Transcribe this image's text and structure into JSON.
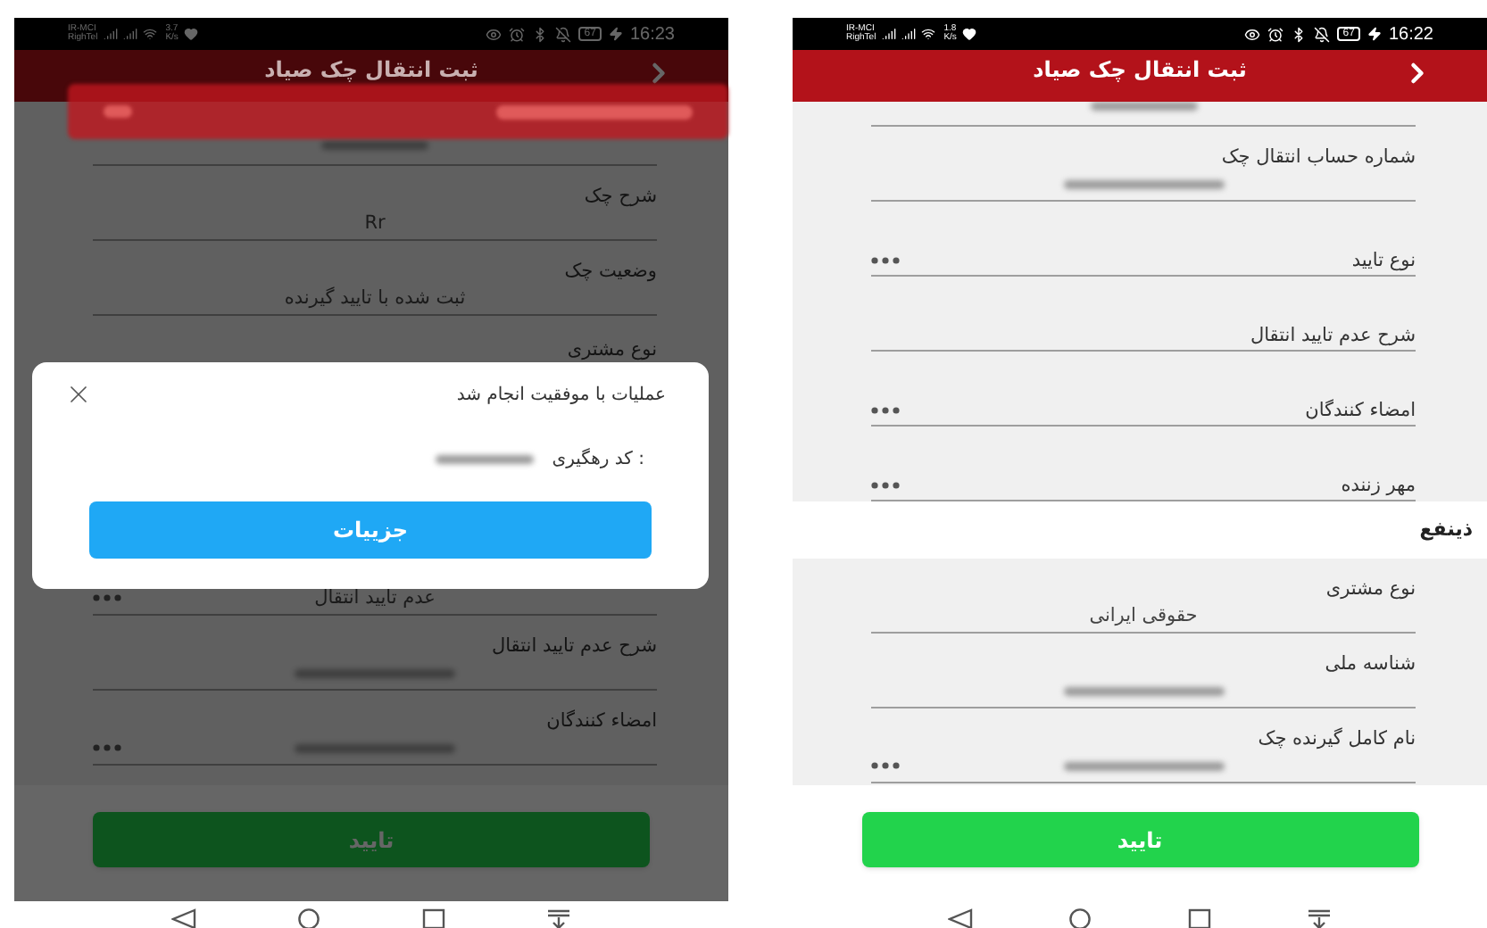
{
  "phones": [
    {
      "status_bar": {
        "carrier": "IR-MCI",
        "carrier_2": "RighTel",
        "speed": "1.8",
        "speed_unit": "K/s",
        "battery": "67",
        "time": "16:22"
      },
      "title": "ثبت انتقال چک صیاد",
      "toast_shown": false,
      "dimmed": false,
      "items": [
        {
          "kind": "partial",
          "blurred": true
        },
        {
          "kind": "field",
          "label": "شماره حساب انتقال چک",
          "blurred": true,
          "menu": false
        },
        {
          "kind": "field",
          "label": "نوع تایید",
          "blurred": false,
          "menu": true
        },
        {
          "kind": "field",
          "label": "شرح عدم تایید انتقال",
          "blurred": false,
          "menu": false
        },
        {
          "kind": "field",
          "label": "امضاء کنندگان",
          "blurred": false,
          "menu": true
        },
        {
          "kind": "field",
          "label": "مهر زننده",
          "blurred": false,
          "menu": true
        },
        {
          "kind": "section",
          "label": "ذینفع"
        },
        {
          "kind": "field",
          "label": "نوع مشتری",
          "value": "حقوقی ایرانی",
          "menu": false
        },
        {
          "kind": "field",
          "label": "شناسه ملی",
          "blurred": true,
          "menu": false
        },
        {
          "kind": "field",
          "label": "نام کامل گیرنده چک",
          "blurred": true,
          "menu": true
        }
      ],
      "confirm_button": "تایید"
    },
    {
      "status_bar": {
        "carrier": "IR-MCI",
        "carrier_2": "RighTel",
        "speed": "3.7",
        "speed_unit": "K/s",
        "battery": "67",
        "time": "16:23"
      },
      "title": "ثبت انتقال چک صیاد",
      "toast_shown": true,
      "dimmed": true,
      "items": [
        {
          "kind": "partial",
          "blurred": true
        },
        {
          "kind": "field",
          "label": "شرح چک",
          "value": "Rr",
          "menu": false
        },
        {
          "kind": "field",
          "label": "وضعیت چک",
          "value": "ثبت شده با تایید گیرنده",
          "menu": false
        },
        {
          "kind": "covered",
          "label": "نوع مشتری"
        }
      ],
      "items_below": [
        {
          "kind": "field",
          "value": "عدم تایید انتقال",
          "menu": true
        },
        {
          "kind": "field",
          "label": "شرح عدم تایید انتقال",
          "blurred": true,
          "menu": false
        },
        {
          "kind": "field",
          "label": "امضاء کنندگان",
          "blurred": true,
          "menu": true
        }
      ],
      "dialog": {
        "message": "عملیات با موفقیت انجام شد",
        "code_label": "کد رهگیری :",
        "code_blurred": true,
        "button": "جزییات"
      },
      "confirm_button": "تایید"
    }
  ]
}
